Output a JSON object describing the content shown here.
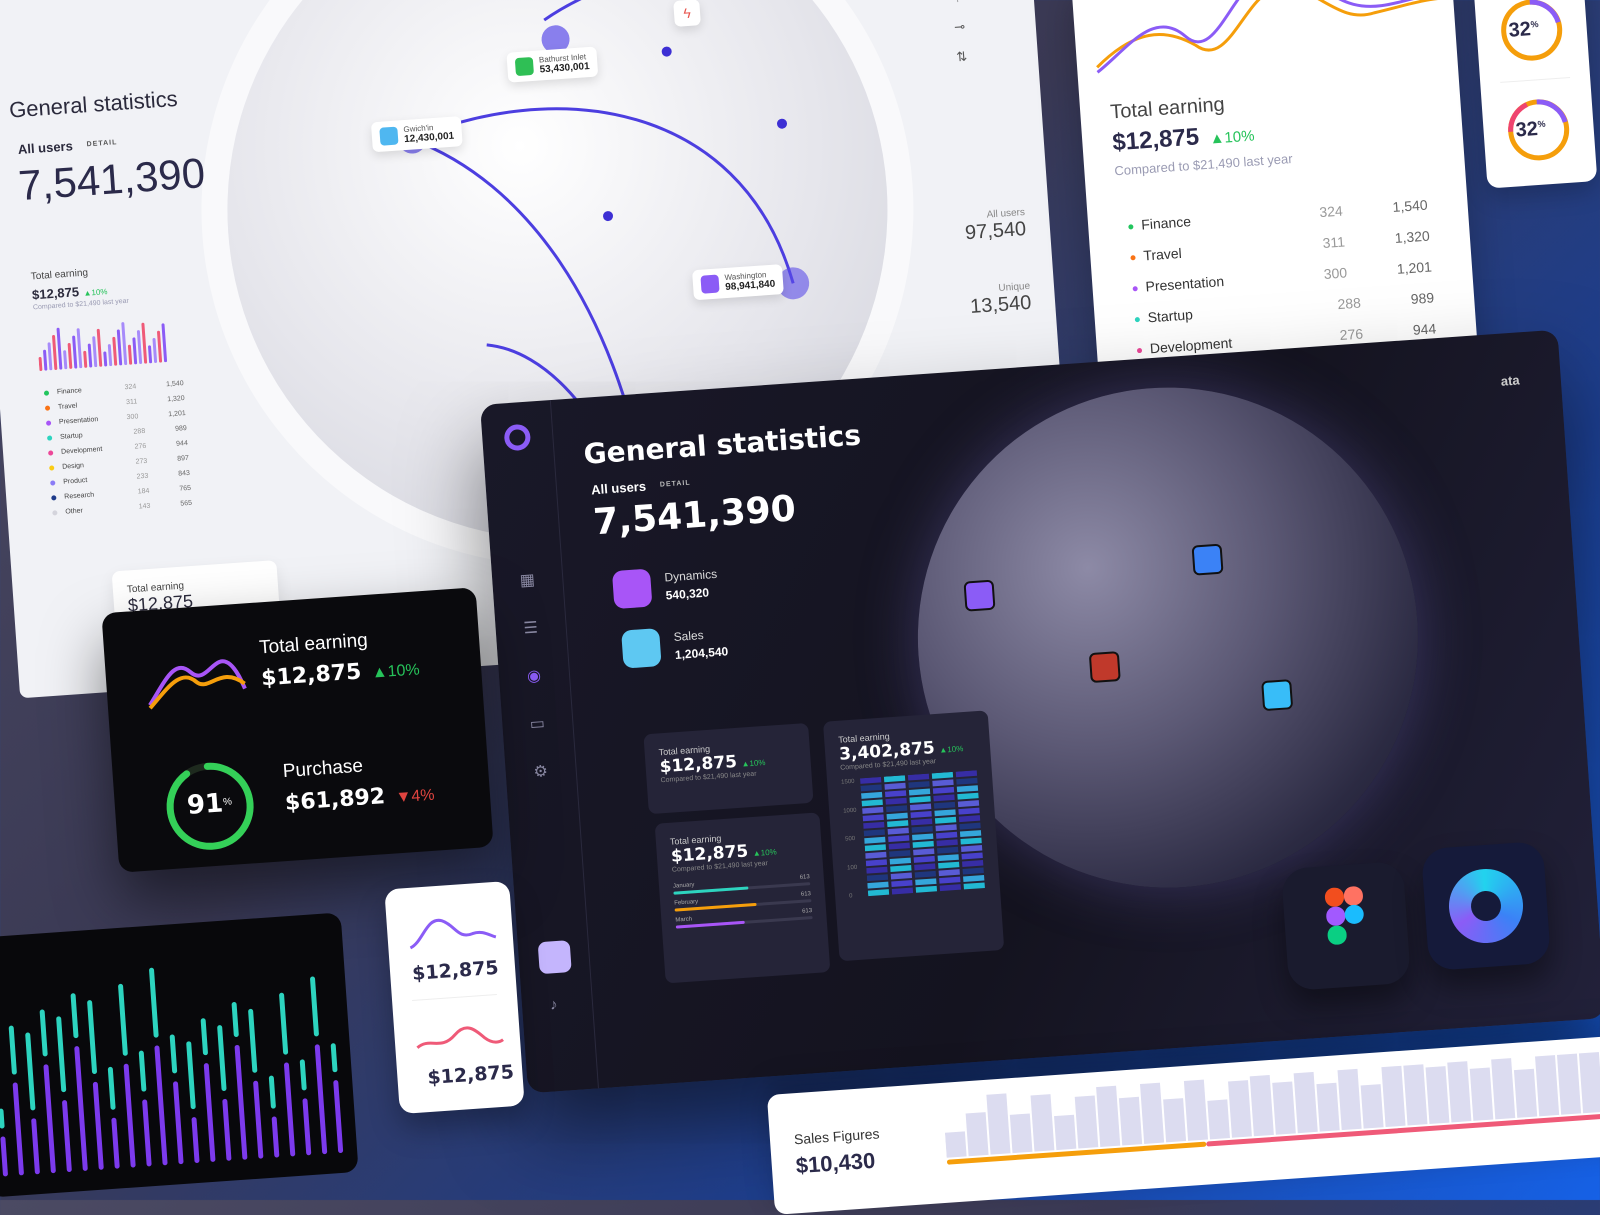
{
  "light_dash": {
    "title": "General statistics",
    "all_users_label": "All users",
    "detail_label": "DETAIL",
    "all_users_value": "7,541,390",
    "total_earning_label": "Total earning",
    "total_earning_value": "$12,875",
    "total_earning_change": "10%",
    "compared": "Compared to $21,490 last year",
    "categories": [
      {
        "name": "Finance",
        "a": "324",
        "b": "1,540",
        "color": "#22c55e"
      },
      {
        "name": "Travel",
        "a": "311",
        "b": "1,320",
        "color": "#f97316"
      },
      {
        "name": "Presentation",
        "a": "300",
        "b": "1,201",
        "color": "#a855f7"
      },
      {
        "name": "Startup",
        "a": "288",
        "b": "989",
        "color": "#2dd4bf"
      },
      {
        "name": "Development",
        "a": "276",
        "b": "944",
        "color": "#ec4899"
      },
      {
        "name": "Design",
        "a": "273",
        "b": "897",
        "color": "#facc15"
      },
      {
        "name": "Product",
        "a": "233",
        "b": "843",
        "color": "#8b7cf6"
      },
      {
        "name": "Research",
        "a": "184",
        "b": "765",
        "color": "#1e3a8a"
      },
      {
        "name": "Other",
        "a": "143",
        "b": "565",
        "color": "#d4d4dc"
      }
    ],
    "right_stats": [
      {
        "label": "All users",
        "value": "97,540"
      },
      {
        "label": "Unique",
        "value": "13,540"
      }
    ],
    "map_markers": [
      {
        "name": "Gwich'in",
        "value": "12,430,001",
        "color": "#4fb7f0"
      },
      {
        "name": "Bathurst Inlet",
        "value": "53,430,001",
        "color": "#2fbf55"
      },
      {
        "name": "Washington",
        "value": "98,941,840",
        "color": "#8b5cf6"
      }
    ],
    "bottom_card": {
      "label": "Total earning",
      "value": "$12,875"
    }
  },
  "earning_card": {
    "label": "Total earning",
    "value": "$12,875",
    "change": "10%",
    "compared": "Compared to $21,490 last year"
  },
  "donut_card": {
    "value": "32",
    "unit": "%"
  },
  "black_card": {
    "earning_label": "Total earning",
    "earning_value": "$12,875",
    "earning_change": "10%",
    "purchase_label": "Purchase",
    "purchase_value": "$61,892",
    "purchase_change": "4%",
    "ring_value": "91",
    "ring_unit": "%",
    "ring_progress": 0.91
  },
  "mini_card": {
    "value1": "$12,875",
    "value2": "$12,875"
  },
  "dark_dash": {
    "title": "General statistics",
    "all_users_label": "All users",
    "detail_label": "DETAIL",
    "all_users_value": "7,541,390",
    "dynamics_label": "Dynamics",
    "dynamics_value": "540,320",
    "sales_label": "Sales",
    "sales_value": "1,204,540",
    "card1": {
      "label": "Total earning",
      "value": "$12,875",
      "change": "10%",
      "compared": "Compared to $21,490 last year"
    },
    "card2": {
      "label": "Total earning",
      "value": "$12,875",
      "change": "10%",
      "compared": "Compared to $21,490 last year",
      "months": [
        {
          "name": "January",
          "value": "613",
          "fill": 0.55,
          "color": "#2dd4bf"
        },
        {
          "name": "February",
          "value": "613",
          "fill": 0.6,
          "color": "#f59e0b"
        },
        {
          "name": "March",
          "value": "613",
          "fill": 0.5,
          "color": "#a855f7"
        }
      ]
    },
    "card3": {
      "label": "Total earning",
      "value": "3,402,875",
      "change": "10%",
      "compared": "Compared to $21,490 last year",
      "y_ticks": [
        "1500",
        "1000",
        "500",
        "100",
        "0"
      ]
    },
    "peek_text": "ata"
  },
  "sales_card": {
    "label": "Sales Figures",
    "value": "$10,430"
  },
  "colors": {
    "accent": "#6c4cf1",
    "green": "#26c35a",
    "red": "#e0443f",
    "dark": "#14131f"
  }
}
